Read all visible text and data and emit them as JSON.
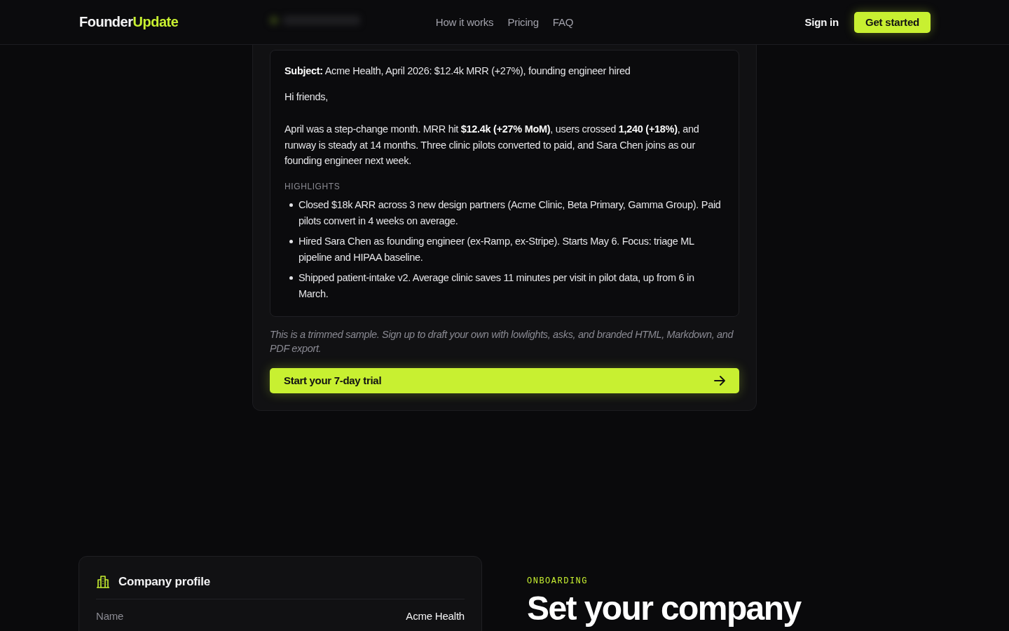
{
  "header": {
    "logo": {
      "text_1": "Founder",
      "text_2": "Update"
    },
    "nav": [
      "How it works",
      "Pricing",
      "FAQ"
    ],
    "sign_in": "Sign in",
    "cta": "Get started"
  },
  "sample": {
    "email": {
      "subject": "**Subject:** Acme Health, April 2026: $12.4k MRR (+27%), founding engineer hired",
      "greeting": "Hi friends,",
      "intro": "April was a step-change month. MRR hit **$12.4k (+27% MoM)**, users crossed **1,240 (+18%)**, and runway is steady at 14 months. Three clinic pilots converted to paid, and Sara Chen joins as our founding engineer next week.",
      "section_label": "HIGHLIGHTS",
      "highlights": [
        "Closed $18k ARR across 3 new design partners (Acme Clinic, Beta Primary, Gamma Group). Paid pilots convert in 4 weeks on average.",
        "Hired Sara Chen as founding engineer (ex-Ramp, ex-Stripe). Starts May 6. Focus: triage ML pipeline and HIPAA baseline.",
        "Shipped patient-intake v2. Average clinic saves 11 minutes per visit in pilot data, up from 6 in March."
      ]
    },
    "note": "This is a trimmed sample. Sign up to draft your own with lowlights, asks, and branded HTML, Markdown, and PDF export.",
    "button": "Start your 7-day trial"
  },
  "profile_card": {
    "title": "Company profile",
    "rows": [
      {
        "label": "Name",
        "value": "Acme Health"
      }
    ]
  },
  "onboarding": {
    "eyebrow": "ONBOARDING",
    "heading": "Set your company"
  }
}
